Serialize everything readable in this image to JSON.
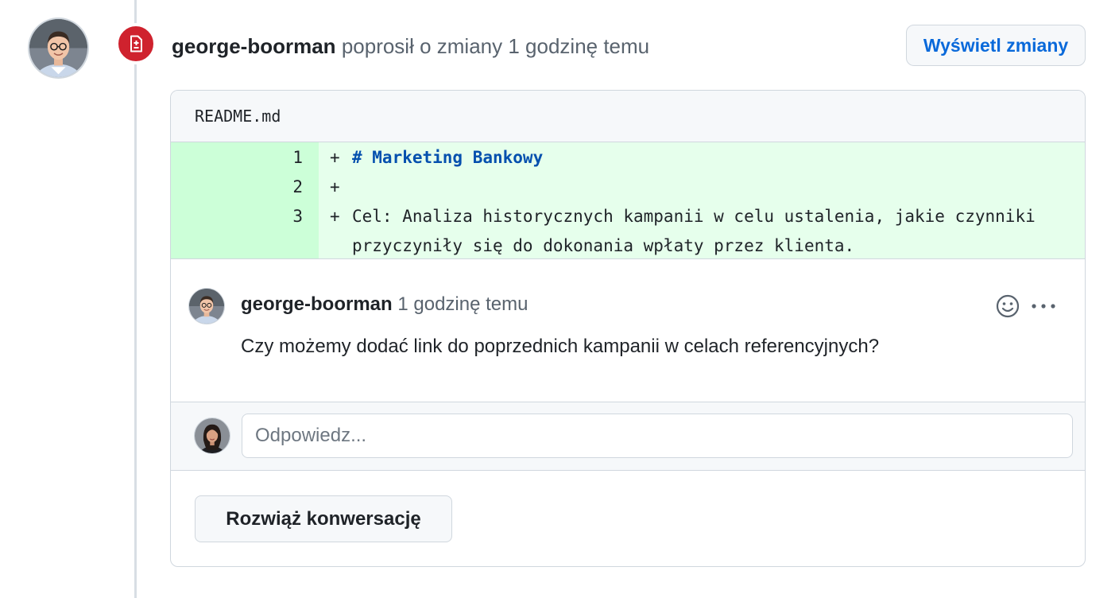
{
  "review": {
    "author": "george-boorman",
    "action": "poprosił o zmiany 1 godzinę temu",
    "view_changes_label": "Wyświetl zmiany",
    "badge_icon": "file-diff-icon",
    "badge_color": "#cf222e"
  },
  "file": {
    "name": "README.md",
    "lines": [
      {
        "number": "1",
        "sign": "+",
        "code": "# Marketing Bankowy"
      },
      {
        "number": "2",
        "sign": "+",
        "code": ""
      },
      {
        "number": "3",
        "sign": "+",
        "code": "Cel: Analiza historycznych kampanii w celu ustalenia, jakie czynniki przyczyniły się do dokonania wpłaty przez klienta."
      }
    ]
  },
  "comment": {
    "author": "george-boorman",
    "time": "1 godzinę temu",
    "body": "Czy możemy dodać link do poprzednich kampanii w celach referencyjnych?",
    "emoji_icon": "smiley-icon",
    "more_icon": "kebab-horizontal-icon"
  },
  "reply": {
    "placeholder": "Odpowiedz..."
  },
  "resolve_label": "Rozwiąż konwersację"
}
